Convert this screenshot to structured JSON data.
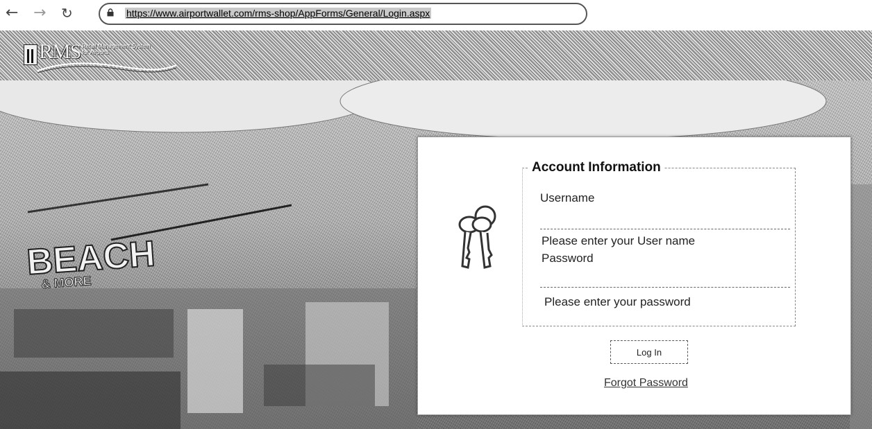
{
  "browser": {
    "url": "https://www.airportwallet.com/rms-shop/AppForms/General/Login.aspx"
  },
  "header": {
    "logo_text": "RMS",
    "logo_subtitle_line1": "Retail Management System",
    "logo_subtitle_line2": "for Airports"
  },
  "login": {
    "section_title": "Account Information",
    "username_label": "Username",
    "username_value": "",
    "username_hint": "Please enter your User name",
    "password_label": "Password",
    "password_value": "",
    "password_hint": "Please enter your password",
    "login_button": "Log In",
    "forgot_link": "Forgot Password"
  },
  "background_sign": "BEACH & MORE",
  "icons": {
    "back": "back-arrow-icon",
    "forward": "forward-arrow-icon",
    "reload": "reload-icon",
    "lock": "lock-icon",
    "keys": "keys-icon"
  }
}
